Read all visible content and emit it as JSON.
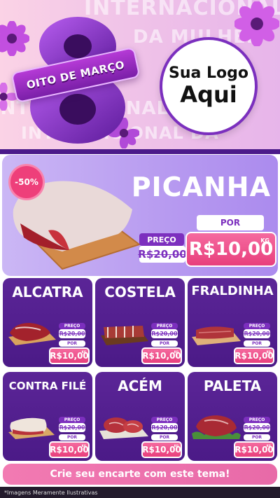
{
  "header": {
    "background_words": [
      "INTERNACIONAL DA MULHER",
      "DA MULHER",
      "INTERNACIONAL",
      "INTERNACIONAL DA"
    ],
    "numeral": "8",
    "ribbon_text": "OITO DE MARÇO",
    "logo_line1": "Sua Logo",
    "logo_line2": "Aqui"
  },
  "hero": {
    "product": "PICANHA",
    "discount": "-50%",
    "old_label": "PREÇO",
    "old_price": "R$20,00",
    "por_label": "POR",
    "new_price": "R$10,00",
    "unit": "KG"
  },
  "products": [
    {
      "name": "ALCATRA",
      "old_label": "PREÇO",
      "old_price": "R$20,00",
      "por_label": "POR",
      "new_price": "R$10,00",
      "unit": "KG"
    },
    {
      "name": "COSTELA",
      "old_label": "PREÇO",
      "old_price": "R$20,00",
      "por_label": "POR",
      "new_price": "R$10,00",
      "unit": "KG"
    },
    {
      "name": "FRALDINHA",
      "old_label": "PREÇO",
      "old_price": "R$20,00",
      "por_label": "POR",
      "new_price": "R$10,00",
      "unit": "KG"
    },
    {
      "name": "CONTRA FILÉ",
      "old_label": "PREÇO",
      "old_price": "R$20,00",
      "por_label": "POR",
      "new_price": "R$10,00",
      "unit": "KG"
    },
    {
      "name": "ACÉM",
      "old_label": "PREÇO",
      "old_price": "R$20,00",
      "por_label": "POR",
      "new_price": "R$10,00",
      "unit": "KG"
    },
    {
      "name": "PALETA",
      "old_label": "PREÇO",
      "old_price": "R$20,00",
      "por_label": "POR",
      "new_price": "R$10,00",
      "unit": "KG"
    }
  ],
  "cta": "Crie seu encarte com este tema!",
  "footer": "*Imagens Meramente Ilustrativas",
  "colors": {
    "brand_purple": "#7c2fbe",
    "card_purple": "#4b1a87",
    "price_pink": "#e83f7c",
    "cta_pink": "#f27ab2"
  }
}
